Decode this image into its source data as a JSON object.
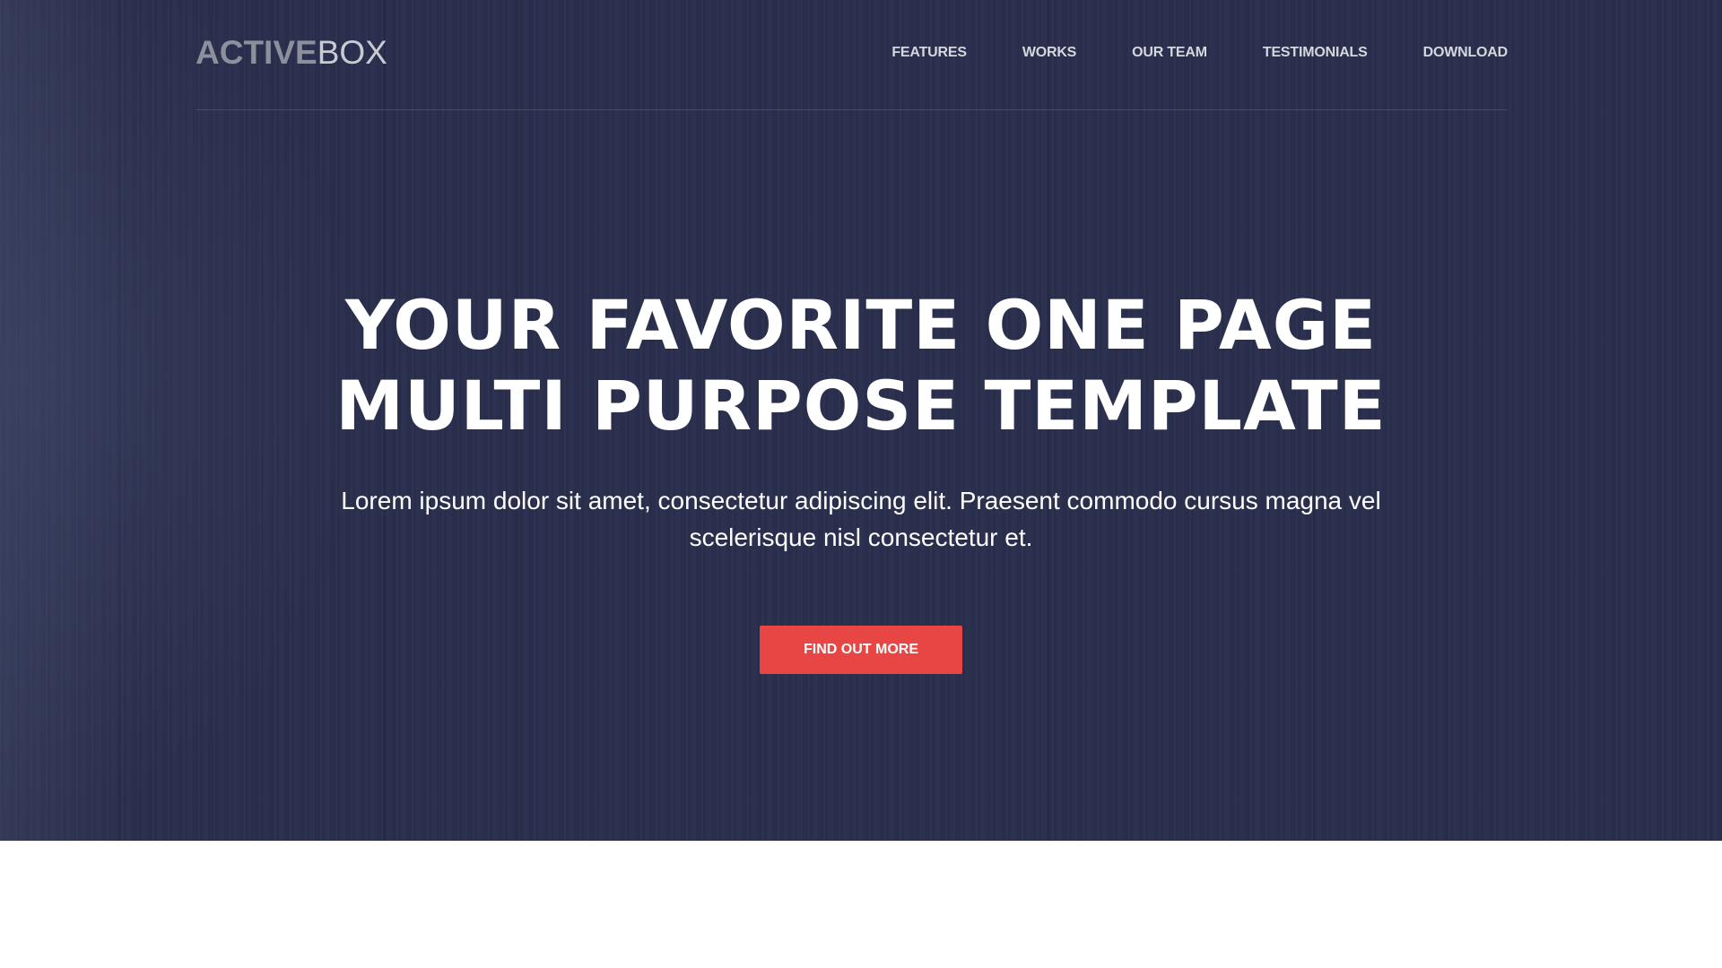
{
  "brand": {
    "logo_bold": "ACTIVE",
    "logo_light": "BOX"
  },
  "nav": {
    "items": [
      "FEATURES",
      "WORKS",
      "OUR TEAM",
      "TESTIMONIALS",
      "DOWNLOAD"
    ]
  },
  "hero": {
    "headline_line1": "YOUR FAVORITE ONE PAGE",
    "headline_line2": "MULTI PURPOSE TEMPLATE",
    "subtext": "Lorem ipsum dolor sit amet, consectetur adipiscing elit. Praesent commodo cursus magna vel scelerisque nisl consectetur et.",
    "cta_label": "FIND OUT MORE"
  },
  "colors": {
    "hero_background": "#2a2f4d",
    "accent": "#e84545",
    "text": "#ffffff"
  }
}
